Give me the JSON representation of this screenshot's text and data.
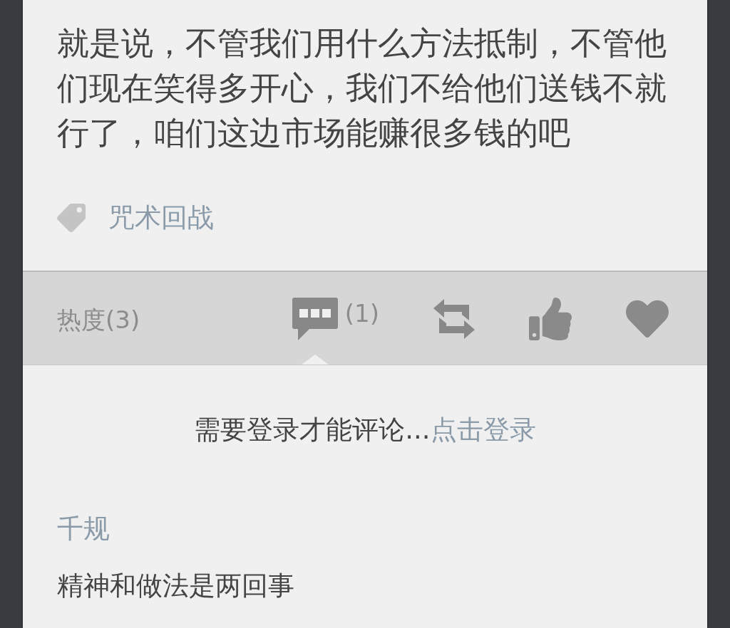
{
  "post": {
    "text": "就是说，不管我们用什么方法抵制，不管他们现在笑得多开心，我们不给他们送钱不就行了，咱们这边市场能赚很多钱的吧",
    "tags": [
      {
        "label": "咒术回战"
      }
    ]
  },
  "actions": {
    "heat": "热度(3)",
    "items": [
      {
        "kind": "comment",
        "count": "(1)",
        "selected": true
      },
      {
        "kind": "repost",
        "selected": false
      },
      {
        "kind": "like",
        "selected": false
      },
      {
        "kind": "favorite",
        "selected": false
      }
    ]
  },
  "comment_box": {
    "prompt": "需要登录才能评论...",
    "link": "点击登录"
  },
  "comments": [
    {
      "author": "千规",
      "text": "精神和做法是两回事"
    }
  ]
}
